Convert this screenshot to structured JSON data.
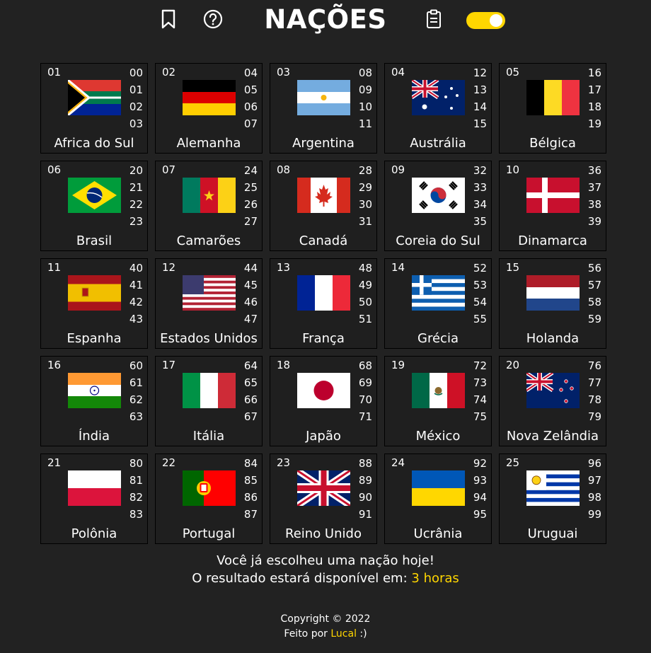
{
  "header": {
    "title": "NAÇÕES",
    "icons": [
      "bookmark-icon",
      "help-icon",
      "clipboard-icon"
    ],
    "toggle_on": true
  },
  "colors": {
    "accent": "#ffd600",
    "background": "#222222",
    "cell": "#1f1f1f"
  },
  "nations": [
    {
      "idx": "01",
      "nums": [
        "00",
        "01",
        "02",
        "03"
      ],
      "name": "Africa do Sul",
      "flag": "za"
    },
    {
      "idx": "02",
      "nums": [
        "04",
        "05",
        "06",
        "07"
      ],
      "name": "Alemanha",
      "flag": "de"
    },
    {
      "idx": "03",
      "nums": [
        "08",
        "09",
        "10",
        "11"
      ],
      "name": "Argentina",
      "flag": "ar"
    },
    {
      "idx": "04",
      "nums": [
        "12",
        "13",
        "14",
        "15"
      ],
      "name": "Austrália",
      "flag": "au"
    },
    {
      "idx": "05",
      "nums": [
        "16",
        "17",
        "18",
        "19"
      ],
      "name": "Bélgica",
      "flag": "be"
    },
    {
      "idx": "06",
      "nums": [
        "20",
        "21",
        "22",
        "23"
      ],
      "name": "Brasil",
      "flag": "br"
    },
    {
      "idx": "07",
      "nums": [
        "24",
        "25",
        "26",
        "27"
      ],
      "name": "Camarões",
      "flag": "cm"
    },
    {
      "idx": "08",
      "nums": [
        "28",
        "29",
        "30",
        "31"
      ],
      "name": "Canadá",
      "flag": "ca"
    },
    {
      "idx": "09",
      "nums": [
        "32",
        "33",
        "34",
        "35"
      ],
      "name": "Coreia do Sul",
      "flag": "kr"
    },
    {
      "idx": "10",
      "nums": [
        "36",
        "37",
        "38",
        "39"
      ],
      "name": "Dinamarca",
      "flag": "dk"
    },
    {
      "idx": "11",
      "nums": [
        "40",
        "41",
        "42",
        "43"
      ],
      "name": "Espanha",
      "flag": "es"
    },
    {
      "idx": "12",
      "nums": [
        "44",
        "45",
        "46",
        "47"
      ],
      "name": "Estados Unidos",
      "flag": "us"
    },
    {
      "idx": "13",
      "nums": [
        "48",
        "49",
        "50",
        "51"
      ],
      "name": "França",
      "flag": "fr"
    },
    {
      "idx": "14",
      "nums": [
        "52",
        "53",
        "54",
        "55"
      ],
      "name": "Grécia",
      "flag": "gr"
    },
    {
      "idx": "15",
      "nums": [
        "56",
        "57",
        "58",
        "59"
      ],
      "name": "Holanda",
      "flag": "nl"
    },
    {
      "idx": "16",
      "nums": [
        "60",
        "61",
        "62",
        "63"
      ],
      "name": "Índia",
      "flag": "in"
    },
    {
      "idx": "17",
      "nums": [
        "64",
        "65",
        "66",
        "67"
      ],
      "name": "Itália",
      "flag": "it"
    },
    {
      "idx": "18",
      "nums": [
        "68",
        "69",
        "70",
        "71"
      ],
      "name": "Japão",
      "flag": "jp"
    },
    {
      "idx": "19",
      "nums": [
        "72",
        "73",
        "74",
        "75"
      ],
      "name": "México",
      "flag": "mx"
    },
    {
      "idx": "20",
      "nums": [
        "76",
        "77",
        "78",
        "79"
      ],
      "name": "Nova Zelândia",
      "flag": "nz"
    },
    {
      "idx": "21",
      "nums": [
        "80",
        "81",
        "82",
        "83"
      ],
      "name": "Polônia",
      "flag": "pl"
    },
    {
      "idx": "22",
      "nums": [
        "84",
        "85",
        "86",
        "87"
      ],
      "name": "Portugal",
      "flag": "pt"
    },
    {
      "idx": "23",
      "nums": [
        "88",
        "89",
        "90",
        "91"
      ],
      "name": "Reino Unido",
      "flag": "gb"
    },
    {
      "idx": "24",
      "nums": [
        "92",
        "93",
        "94",
        "95"
      ],
      "name": "Ucrânia",
      "flag": "ua"
    },
    {
      "idx": "25",
      "nums": [
        "96",
        "97",
        "98",
        "99"
      ],
      "name": "Uruguai",
      "flag": "uy"
    }
  ],
  "message": {
    "line1": "Você já escolheu uma nação hoje!",
    "line2_prefix": "O resultado estará disponível em: ",
    "line2_time": "3 horas"
  },
  "footer": {
    "copyright": "Copyright © 2022",
    "made_by_prefix": "Feito por ",
    "author": "Lucal",
    "made_by_suffix": " :)"
  }
}
